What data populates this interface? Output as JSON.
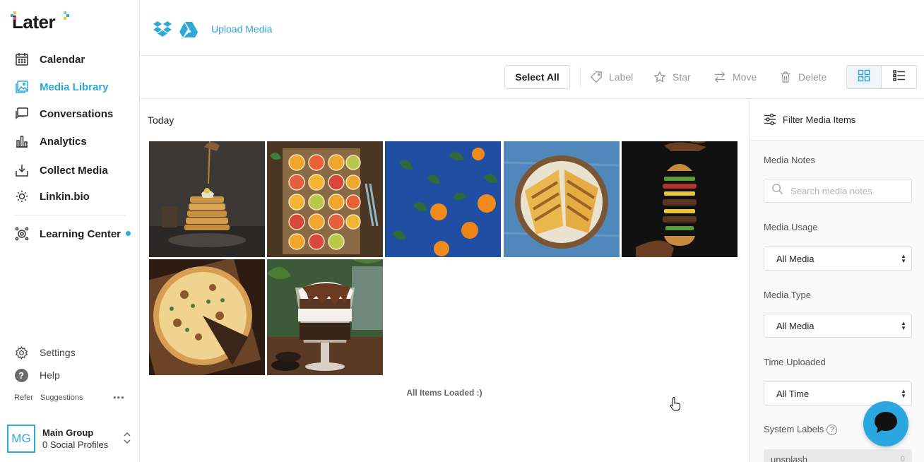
{
  "brand": {
    "logo_text": "Later",
    "accent": "#2ea8d9"
  },
  "sidebar": {
    "items": [
      {
        "label": "Calendar",
        "icon": "calendar-icon"
      },
      {
        "label": "Media Library",
        "icon": "image-icon",
        "active": true
      },
      {
        "label": "Conversations",
        "icon": "chat-icon"
      },
      {
        "label": "Analytics",
        "icon": "bar-chart-icon"
      },
      {
        "label": "Collect Media",
        "icon": "download-tray-icon"
      },
      {
        "label": "Linkin.bio",
        "icon": "link-bio-icon"
      },
      {
        "label": "Learning Center",
        "icon": "learning-icon",
        "has_new_dot": true
      }
    ],
    "settings_label": "Settings",
    "help_label": "Help",
    "refer_label": "Refer",
    "suggestions_label": "Suggestions",
    "group": {
      "initials": "MG",
      "name": "Main Group",
      "profiles": "0 Social Profiles"
    }
  },
  "topbar": {
    "sources": [
      "dropbox-icon",
      "google-drive-icon"
    ],
    "upload_label": "Upload Media"
  },
  "toolbar": {
    "select_all": "Select All",
    "label": "Label",
    "star": "Star",
    "move": "Move",
    "delete": "Delete",
    "view_modes": [
      "grid-view-icon",
      "list-view-icon"
    ],
    "active_view": "grid"
  },
  "media": {
    "section_heading": "Today",
    "items": [
      {
        "subject": "pancakes",
        "bg": "#3a3734"
      },
      {
        "subject": "citrus-slices",
        "bg": "#5a3b22"
      },
      {
        "subject": "oranges-on-blue",
        "bg": "#1f4fa3"
      },
      {
        "subject": "grilled-sandwich",
        "bg": "#4f86b8"
      },
      {
        "subject": "floating-burger",
        "bg": "#121212"
      },
      {
        "subject": "pizza",
        "bg": "#3b2418"
      },
      {
        "subject": "chocolate-dessert",
        "bg": "#3e5b38"
      }
    ],
    "loaded_text": "All Items Loaded :)"
  },
  "filters": {
    "title": "Filter Media Items",
    "notes_label": "Media Notes",
    "notes_placeholder": "Search media notes",
    "usage_label": "Media Usage",
    "usage_value": "All Media",
    "type_label": "Media Type",
    "type_value": "All Media",
    "time_label": "Time Uploaded",
    "time_value": "All Time",
    "system_labels_title": "System Labels",
    "system_label_item": "unsplash",
    "system_label_count": "0"
  }
}
